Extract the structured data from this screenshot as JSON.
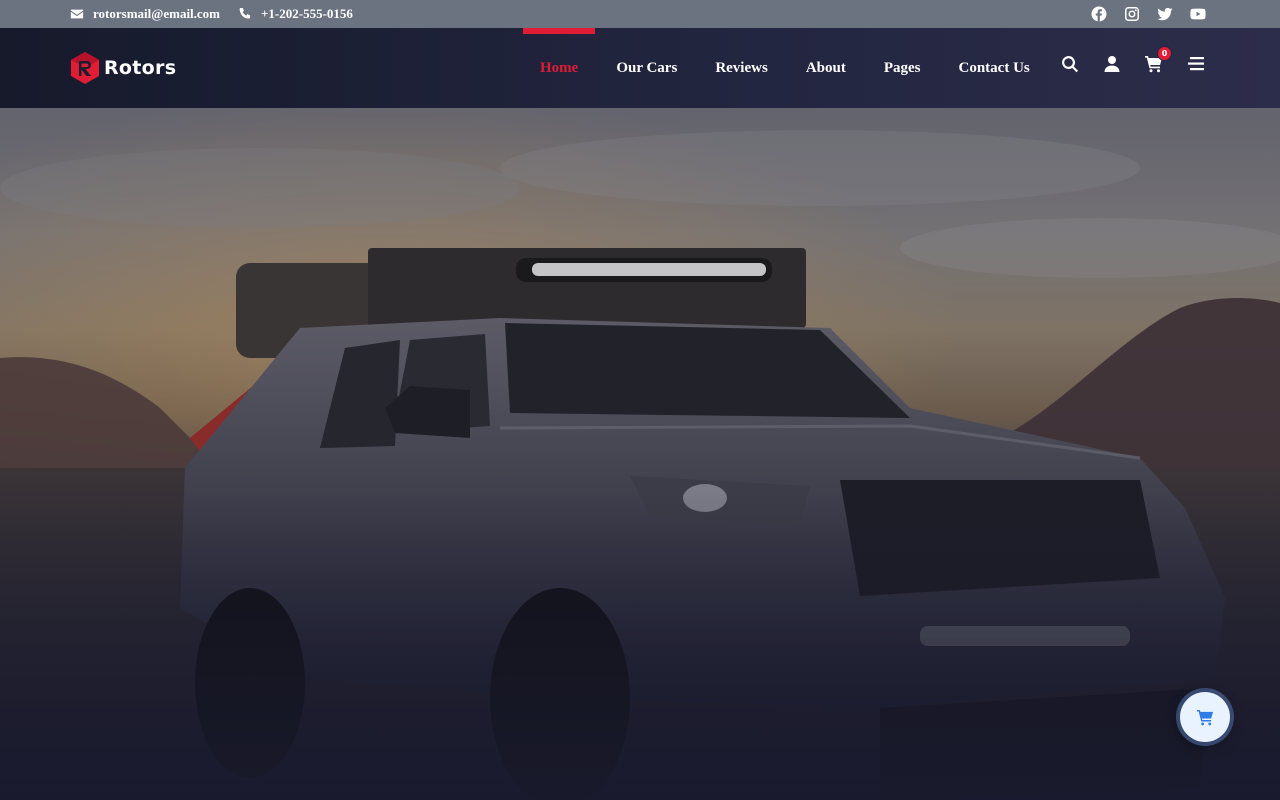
{
  "topbar": {
    "email": "rotorsmail@email.com",
    "phone": "+1-202-555-0156",
    "socials": [
      "facebook-icon",
      "instagram-icon",
      "twitter-icon",
      "youtube-icon"
    ]
  },
  "brand": {
    "name": "Rotors",
    "accent": "#e11d36"
  },
  "nav": {
    "items": [
      {
        "label": "Home",
        "active": true
      },
      {
        "label": "Our Cars"
      },
      {
        "label": "Reviews"
      },
      {
        "label": "About"
      },
      {
        "label": "Pages"
      },
      {
        "label": "Contact Us"
      }
    ]
  },
  "header_icons": {
    "icons": [
      "search-icon",
      "user-icon",
      "cart-icon",
      "menu-icon"
    ],
    "cart_count": "0"
  },
  "hero": {
    "image": "pickup-truck-desert-dusk"
  },
  "floating_cart": {
    "icon": "cart-icon",
    "color": "#2f7ce8"
  }
}
